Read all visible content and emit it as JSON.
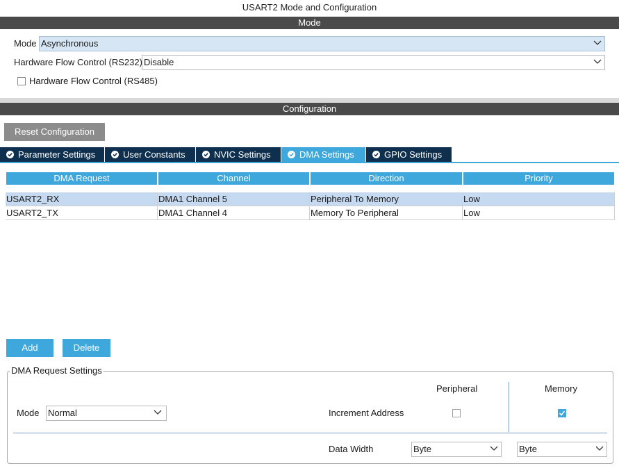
{
  "window": {
    "title": "USART2 Mode and Configuration"
  },
  "mode_section": {
    "header": "Mode",
    "mode_label": "Mode",
    "mode_value": "Asynchronous",
    "hw_flow_rs232_label": "Hardware Flow Control (RS232)",
    "hw_flow_rs232_value": "Disable",
    "hw_flow_rs485_label": "Hardware Flow Control (RS485)",
    "hw_flow_rs485_checked": false
  },
  "config_section": {
    "header": "Configuration",
    "reset_button": "Reset Configuration",
    "tabs": [
      {
        "label": "Parameter Settings",
        "icon": "check-circle-icon",
        "active": false
      },
      {
        "label": "User Constants",
        "icon": "check-circle-icon",
        "active": false
      },
      {
        "label": "NVIC Settings",
        "icon": "check-circle-icon",
        "active": false
      },
      {
        "label": "DMA Settings",
        "icon": "check-circle-icon",
        "active": true
      },
      {
        "label": "GPIO Settings",
        "icon": "check-circle-icon",
        "active": false
      }
    ]
  },
  "dma_table": {
    "columns": [
      "DMA Request",
      "Channel",
      "Direction",
      "Priority"
    ],
    "rows": [
      {
        "request": "USART2_RX",
        "channel": "DMA1 Channel 5",
        "direction": "Peripheral To Memory",
        "priority": "Low",
        "selected": true
      },
      {
        "request": "USART2_TX",
        "channel": "DMA1 Channel 4",
        "direction": "Memory To Peripheral",
        "priority": "Low",
        "selected": false
      }
    ]
  },
  "actions": {
    "add": "Add",
    "delete": "Delete"
  },
  "dma_request_settings": {
    "legend": "DMA Request Settings",
    "peripheral_header": "Peripheral",
    "memory_header": "Memory",
    "mode_label": "Mode",
    "mode_value": "Normal",
    "increment_address_label": "Increment Address",
    "peripheral_increment_checked": false,
    "memory_increment_checked": true,
    "data_width_label": "Data Width",
    "peripheral_data_width": "Byte",
    "memory_data_width": "Byte"
  },
  "colors": {
    "accent": "#3ea7db",
    "tab_dark": "#0e2f4d",
    "section_bar": "#4a4a4a",
    "selected_row": "#c5daf0"
  }
}
